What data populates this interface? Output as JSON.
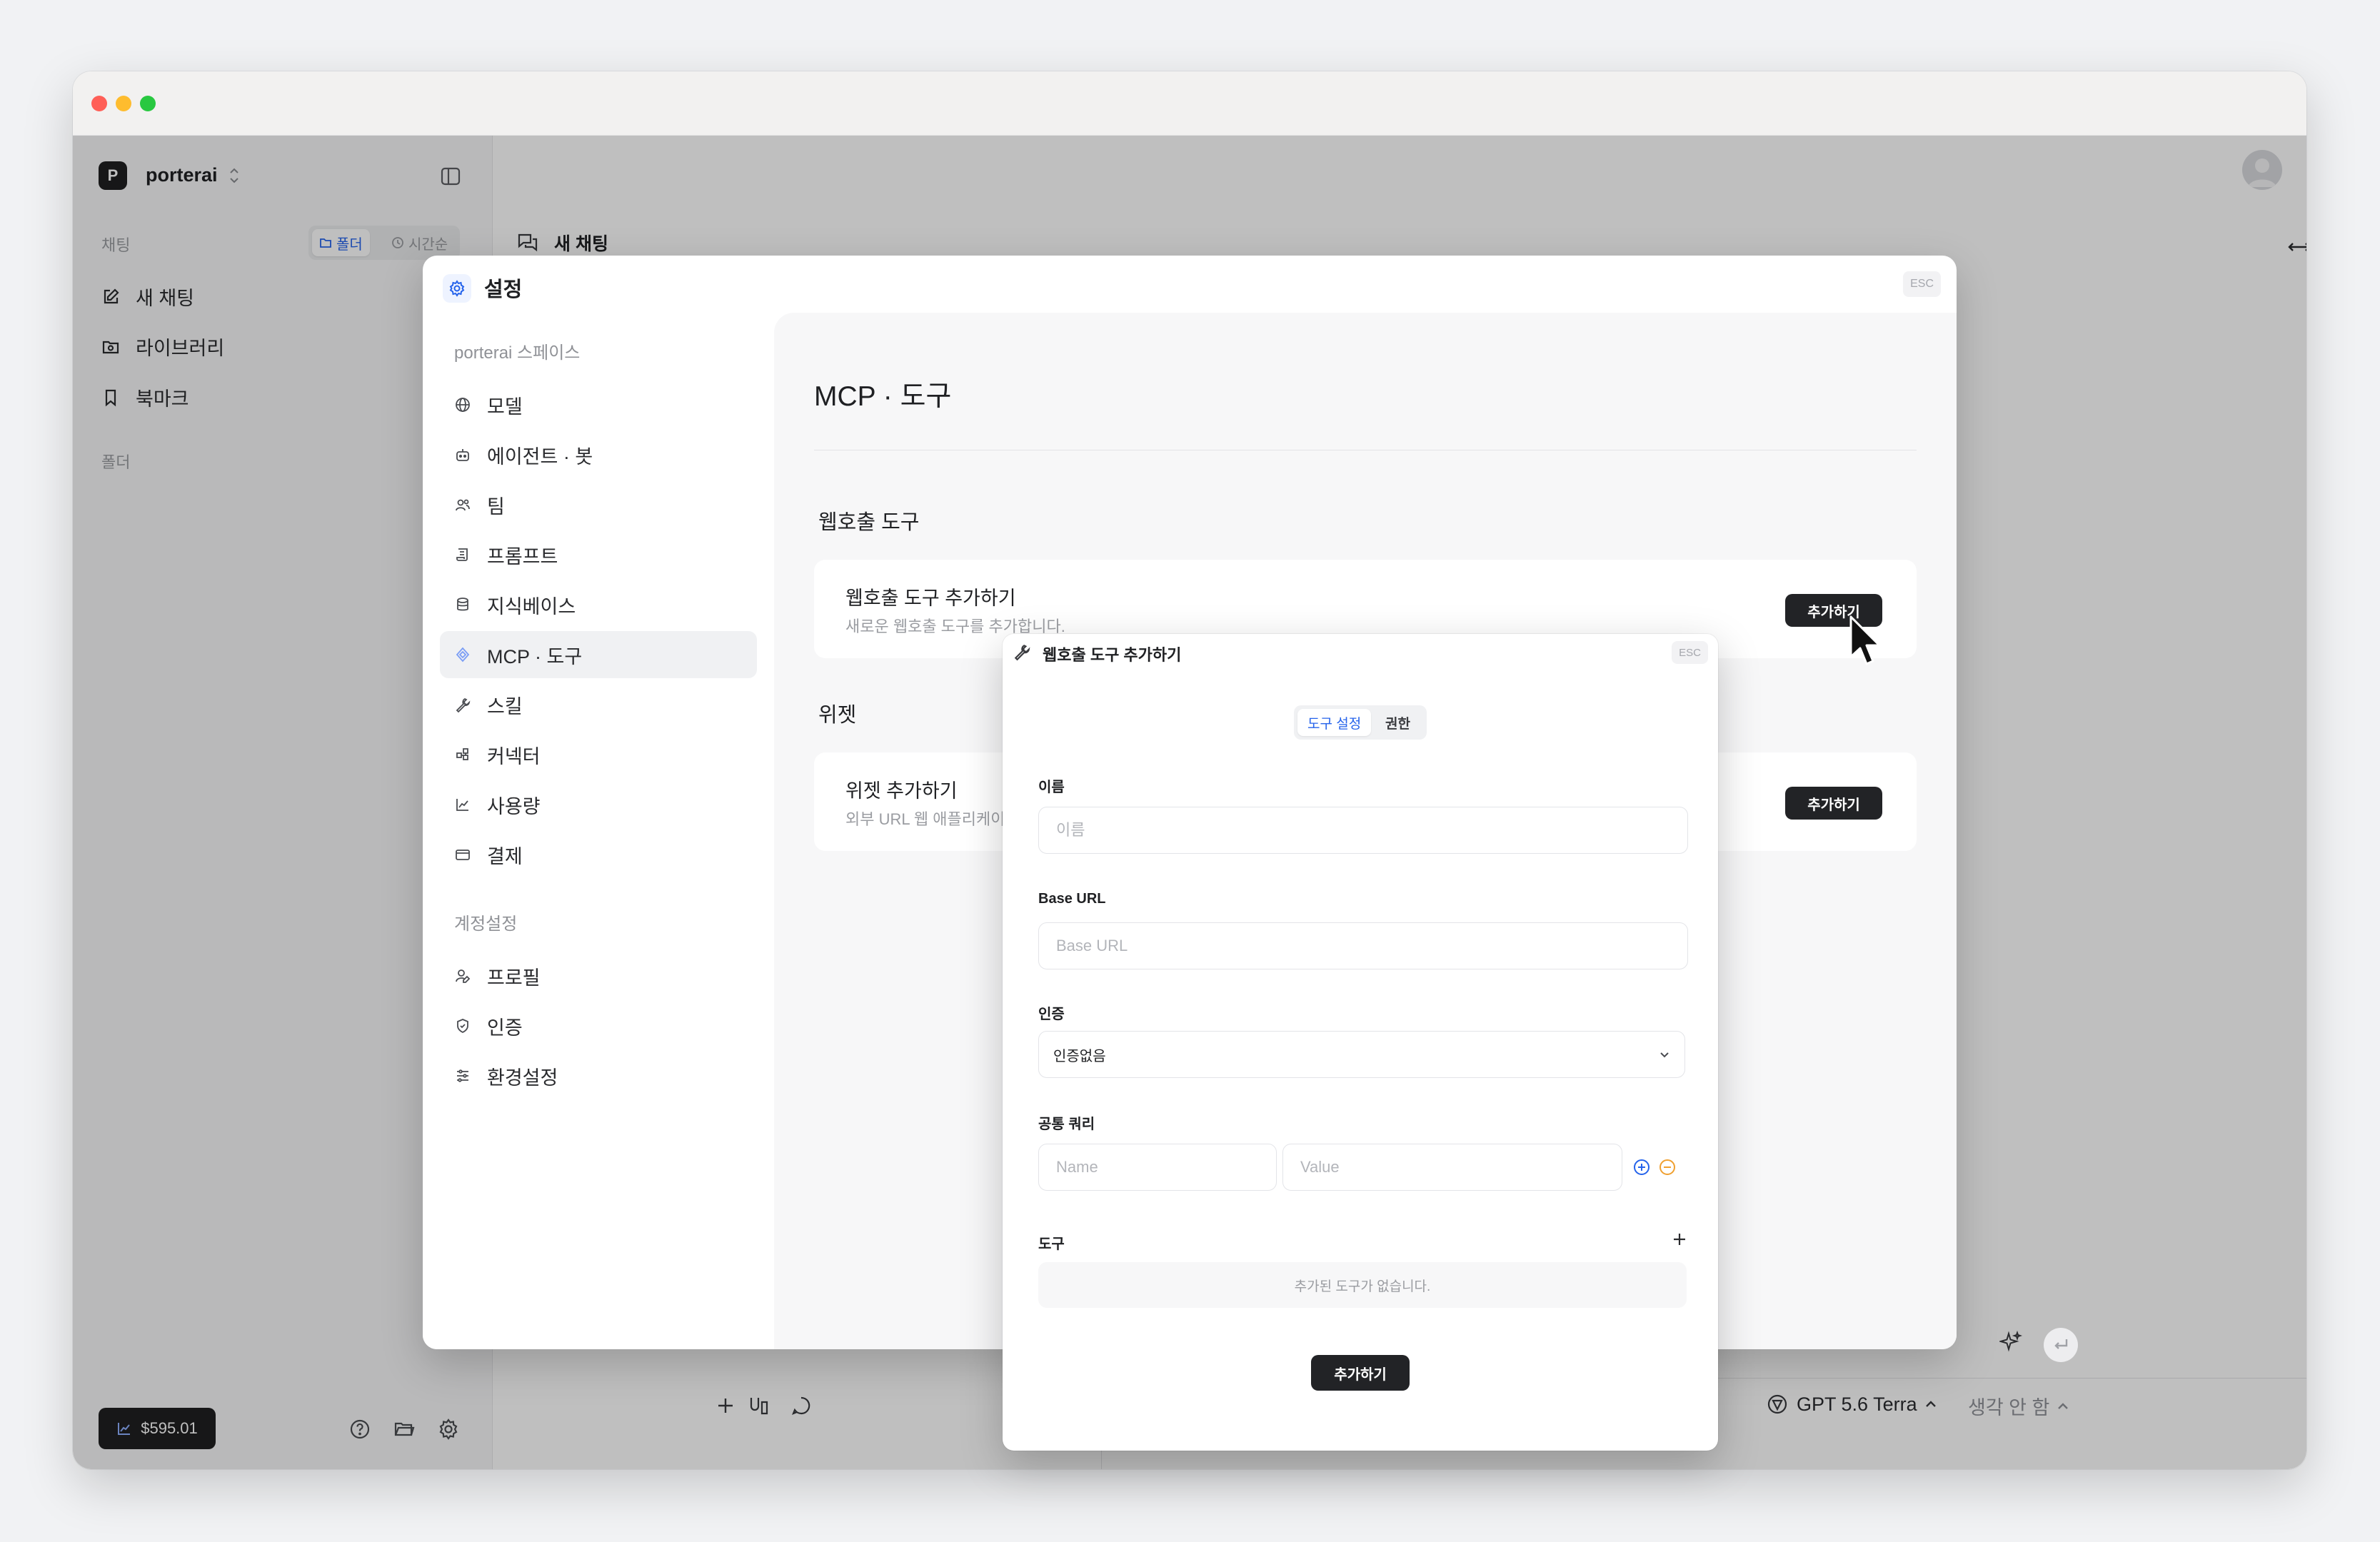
{
  "app": {
    "workspace_initial": "P",
    "workspace_name": "porterai"
  },
  "sidebar": {
    "chat_section": "채팅",
    "view_toggle": [
      {
        "label": "폴더",
        "icon": "folder-icon",
        "active": true
      },
      {
        "label": "시간순",
        "icon": "clock-icon",
        "active": false
      }
    ],
    "nav": [
      {
        "label": "새 채팅",
        "icon": "edit-icon"
      },
      {
        "label": "라이브러리",
        "icon": "library-icon"
      },
      {
        "label": "북마크",
        "icon": "bookmark-icon"
      }
    ],
    "folder_section": "폴더",
    "credit": "$595.01"
  },
  "main": {
    "chat_title": "새 채팅",
    "composer": {
      "model": "GPT 5.6 Terra",
      "thinking": "생각 안 함"
    }
  },
  "settings": {
    "title": "설정",
    "esc": "ESC",
    "workspace_section": "porterai 스페이스",
    "workspace_items": [
      {
        "label": "모델",
        "icon": "globe-icon"
      },
      {
        "label": "에이전트 · 봇",
        "icon": "bot-icon"
      },
      {
        "label": "팀",
        "icon": "users-icon"
      },
      {
        "label": "프롬프트",
        "icon": "scroll-icon"
      },
      {
        "label": "지식베이스",
        "icon": "database-icon"
      },
      {
        "label": "MCP · 도구",
        "icon": "mcp-icon",
        "active": true
      },
      {
        "label": "스킬",
        "icon": "wrench-icon"
      },
      {
        "label": "커넥터",
        "icon": "connector-icon"
      },
      {
        "label": "사용량",
        "icon": "chart-icon"
      },
      {
        "label": "결제",
        "icon": "card-icon"
      }
    ],
    "account_section": "계정설정",
    "account_items": [
      {
        "label": "프로필",
        "icon": "user-edit-icon"
      },
      {
        "label": "인증",
        "icon": "shield-icon"
      },
      {
        "label": "환경설정",
        "icon": "sliders-icon"
      }
    ],
    "page_title": "MCP · 도구",
    "webhook_section": "웹호출 도구",
    "webhook_card": {
      "title": "웹호출 도구 추가하기",
      "desc": "새로운 웹호출 도구를 추가합니다.",
      "button": "추가하기"
    },
    "widget_section": "위젯",
    "widget_card": {
      "title": "위젯 추가하기",
      "desc": "외부 URL 웹 애플리케이",
      "button": "추가하기"
    }
  },
  "dialog": {
    "title": "웹호출 도구 추가하기",
    "esc": "ESC",
    "tabs": [
      {
        "label": "도구 설정",
        "active": true
      },
      {
        "label": "권한",
        "active": false
      }
    ],
    "name_label": "이름",
    "name_placeholder": "이름",
    "base_url_label": "Base URL",
    "base_url_placeholder": "Base URL",
    "auth_label": "인증",
    "auth_value": "인증없음",
    "query_label": "공통 쿼리",
    "query_name_placeholder": "Name",
    "query_value_placeholder": "Value",
    "tools_label": "도구",
    "tools_empty": "추가된 도구가 없습니다.",
    "submit": "추가하기"
  },
  "colors": {
    "accent": "#2563eb",
    "dark_button": "#222326",
    "traffic_red": "#ff5f57",
    "traffic_yellow": "#febc2e",
    "traffic_green": "#28c840",
    "remove_orange": "#f0a030"
  }
}
